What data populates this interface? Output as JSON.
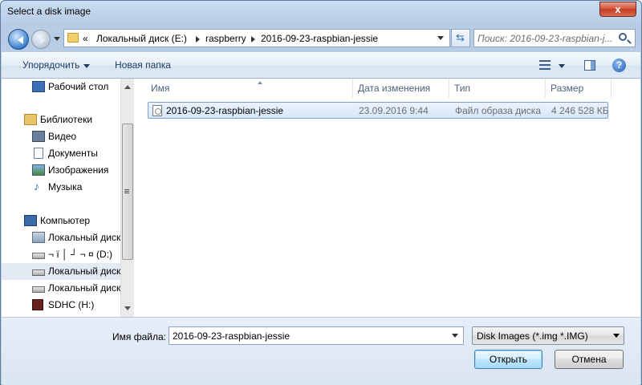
{
  "window": {
    "title": "Select a disk image",
    "close_label": "x"
  },
  "address": {
    "segments": [
      "Локальный диск (E:)",
      "raspberry",
      "2016-09-23-raspbian-jessie"
    ],
    "overflow": "«"
  },
  "search": {
    "placeholder": "Поиск: 2016-09-23-raspbian-j..."
  },
  "toolbar": {
    "organize_label": "Упорядочить",
    "new_folder_label": "Новая папка",
    "help_label": "?"
  },
  "nav": {
    "items": [
      {
        "label": "Рабочий стол",
        "icon": "desktop-icon"
      },
      {
        "label": "Библиотеки",
        "icon": "libraries-icon"
      },
      {
        "label": "Видео",
        "icon": "video-icon"
      },
      {
        "label": "Документы",
        "icon": "documents-icon"
      },
      {
        "label": "Изображения",
        "icon": "pictures-icon"
      },
      {
        "label": "Музыка",
        "icon": "music-icon"
      },
      {
        "label": "Компьютер",
        "icon": "computer-icon"
      },
      {
        "label": "Локальный диск",
        "icon": "system-drive-icon"
      },
      {
        "label": "¬ ї │ ┘ ¬ ¤ (D:)",
        "icon": "drive-icon"
      },
      {
        "label": "Локальный диск",
        "icon": "drive-icon",
        "selected": true
      },
      {
        "label": "Локальный диск",
        "icon": "drive-icon"
      },
      {
        "label": "SDHC (H:)",
        "icon": "sd-card-icon"
      }
    ]
  },
  "columns": [
    "Имя",
    "Дата изменения",
    "Тип",
    "Размер"
  ],
  "files": [
    {
      "name": "2016-09-23-raspbian-jessie",
      "date": "23.09.2016 9:44",
      "type": "Файл образа диска",
      "size": "4 246 528 КБ"
    }
  ],
  "bottom": {
    "file_name_label": "Имя файла:",
    "file_name_value": "2016-09-23-raspbian-jessie",
    "file_type_value": "Disk Images (*.img *.IMG)",
    "open_label": "Открыть",
    "cancel_label": "Отмена"
  }
}
